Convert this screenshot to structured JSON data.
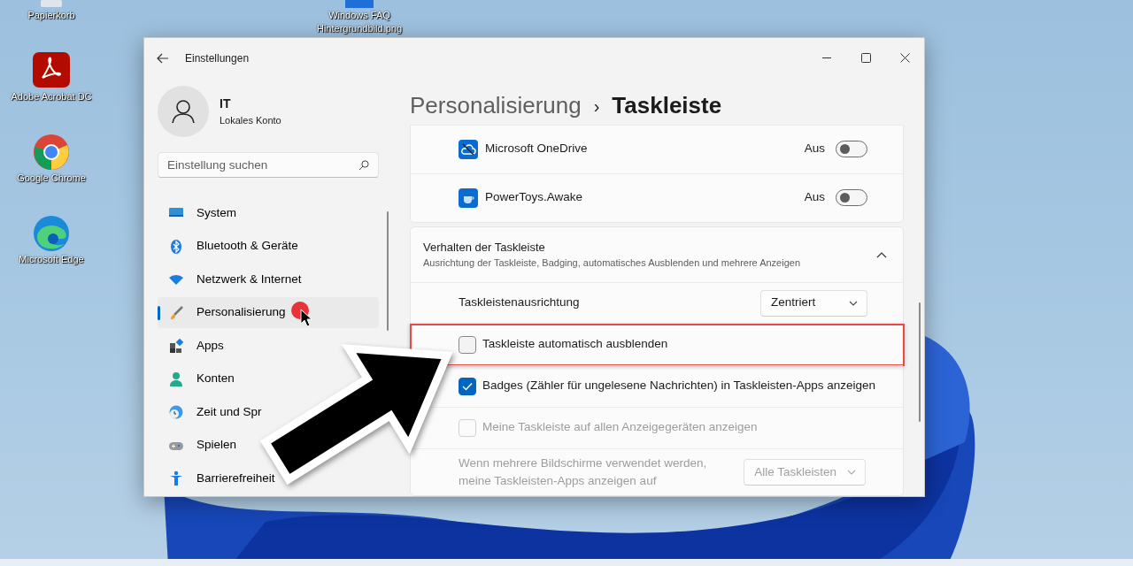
{
  "desktop": {
    "icons": [
      {
        "kind": "bin",
        "label": "Papierkorb"
      },
      {
        "kind": "image",
        "label": "Windows FAQ Hintergrundbild.png"
      },
      {
        "kind": "acrobat",
        "label": "Adobe Acrobat DC"
      },
      {
        "kind": "chrome",
        "label": "Google Chrome"
      },
      {
        "kind": "edge",
        "label": "Microsoft Edge"
      }
    ]
  },
  "window": {
    "title": "Einstellungen"
  },
  "account": {
    "name": "IT",
    "type": "Lokales Konto"
  },
  "search": {
    "placeholder": "Einstellung suchen"
  },
  "nav": [
    {
      "kind": "system",
      "label": "System",
      "selected": false
    },
    {
      "kind": "bluetooth",
      "label": "Bluetooth & Geräte",
      "selected": false
    },
    {
      "kind": "network",
      "label": "Netzwerk & Internet",
      "selected": false
    },
    {
      "kind": "brush",
      "label": "Personalisierung",
      "selected": true
    },
    {
      "kind": "apps",
      "label": "Apps",
      "selected": false
    },
    {
      "kind": "accounts",
      "label": "Konten",
      "selected": false
    },
    {
      "kind": "time",
      "label": "Zeit und Spr",
      "selected": false
    },
    {
      "kind": "gaming",
      "label": "Spielen",
      "selected": false
    },
    {
      "kind": "access",
      "label": "Barrierefreiheit",
      "selected": false
    }
  ],
  "breadcrumb": {
    "parent": "Personalisierung",
    "separator": "›",
    "current": "Taskleiste"
  },
  "app_rows": [
    {
      "kind": "onedrive",
      "name": "Microsoft OneDrive",
      "state": "Aus",
      "on": false
    },
    {
      "kind": "awake",
      "name": "PowerToys.Awake",
      "state": "Aus",
      "on": false
    }
  ],
  "section": {
    "title": "Verhalten der Taskleiste",
    "subtitle": "Ausrichtung der Taskleiste, Badging, automatisches Ausblenden und mehrere Anzeigen",
    "expanded": true
  },
  "settings": [
    {
      "kind": "dropdown",
      "label": "Taskleistenausrichtung",
      "value": "Zentriert",
      "disabled": false,
      "highlighted": false
    },
    {
      "kind": "checkbox",
      "label": "Taskleiste automatisch ausblenden",
      "checked": false,
      "disabled": false,
      "highlighted": true
    },
    {
      "kind": "checkbox",
      "label": "Badges (Zähler für ungelesene Nachrichten) in Taskleisten-Apps anzeigen",
      "checked": true,
      "disabled": false,
      "highlighted": false
    },
    {
      "kind": "checkbox",
      "label": "Meine Taskleiste auf allen Anzeigegeräten anzeigen",
      "checked": false,
      "disabled": true,
      "highlighted": false
    },
    {
      "kind": "dropdown",
      "label": "Wenn mehrere Bildschirme verwendet werden, meine Taskleisten-Apps anzeigen auf",
      "value": "Alle Taskleisten",
      "disabled": true,
      "highlighted": false
    }
  ]
}
